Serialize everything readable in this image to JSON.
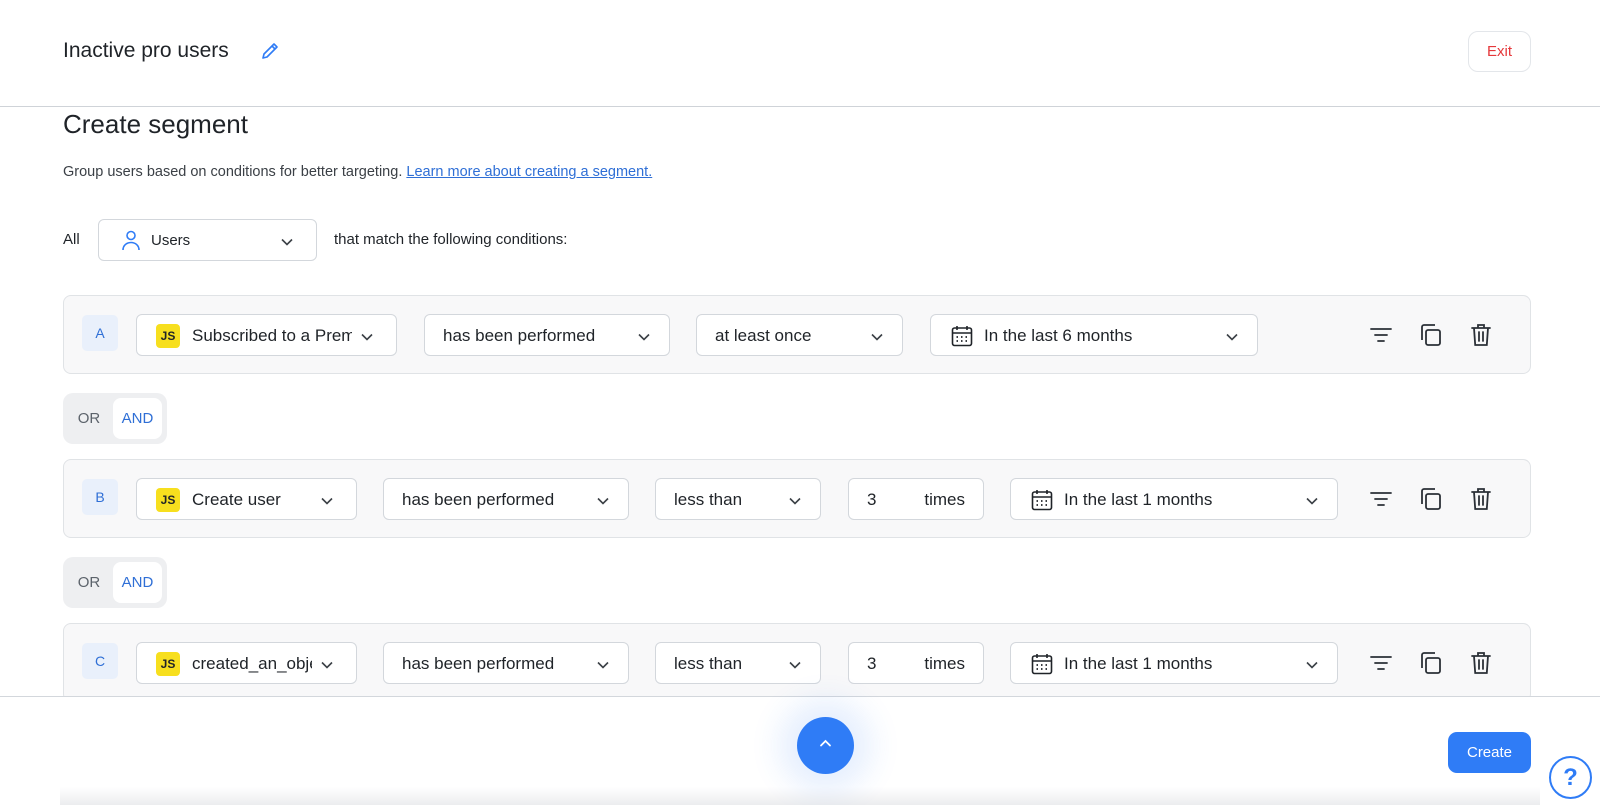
{
  "header": {
    "title": "Inactive pro users",
    "exit_label": "Exit"
  },
  "main": {
    "title": "Create segment",
    "description": "Group users based on conditions for better targeting.",
    "learn_more_link": "Learn more about creating a segment.",
    "all_label": "All",
    "entity_select": "Users",
    "match_label": "that match the following conditions:"
  },
  "conditions": [
    {
      "letter": "A",
      "event": "Subscribed to a Premium",
      "operator": "has been performed",
      "frequency": "at least once",
      "timeframe": "In the last 6 months"
    },
    {
      "letter": "B",
      "event": "Create user",
      "operator": "has been performed",
      "frequency": "less than",
      "count": "3",
      "count_unit": "times",
      "timeframe": "In the last 1 months"
    },
    {
      "letter": "C",
      "event": "created_an_object",
      "operator": "has been performed",
      "frequency": "less than",
      "count": "3",
      "count_unit": "times",
      "timeframe": "In the last 1 months"
    }
  ],
  "logic": [
    {
      "or_label": "OR",
      "and_label": "AND",
      "selected": "AND"
    },
    {
      "or_label": "OR",
      "and_label": "AND",
      "selected": "AND"
    }
  ],
  "event_badge": "JS",
  "footer": {
    "create_label": "Create",
    "help_label": "?"
  },
  "colors": {
    "accent": "#2f7cf6",
    "danger": "#e5383b",
    "js_badge": "#f7df1e"
  },
  "icons": [
    "pencil-icon",
    "user-icon",
    "chevron-down-icon",
    "calendar-icon",
    "filter-icon",
    "copy-icon",
    "trash-icon",
    "chevron-up-icon",
    "help-icon"
  ]
}
